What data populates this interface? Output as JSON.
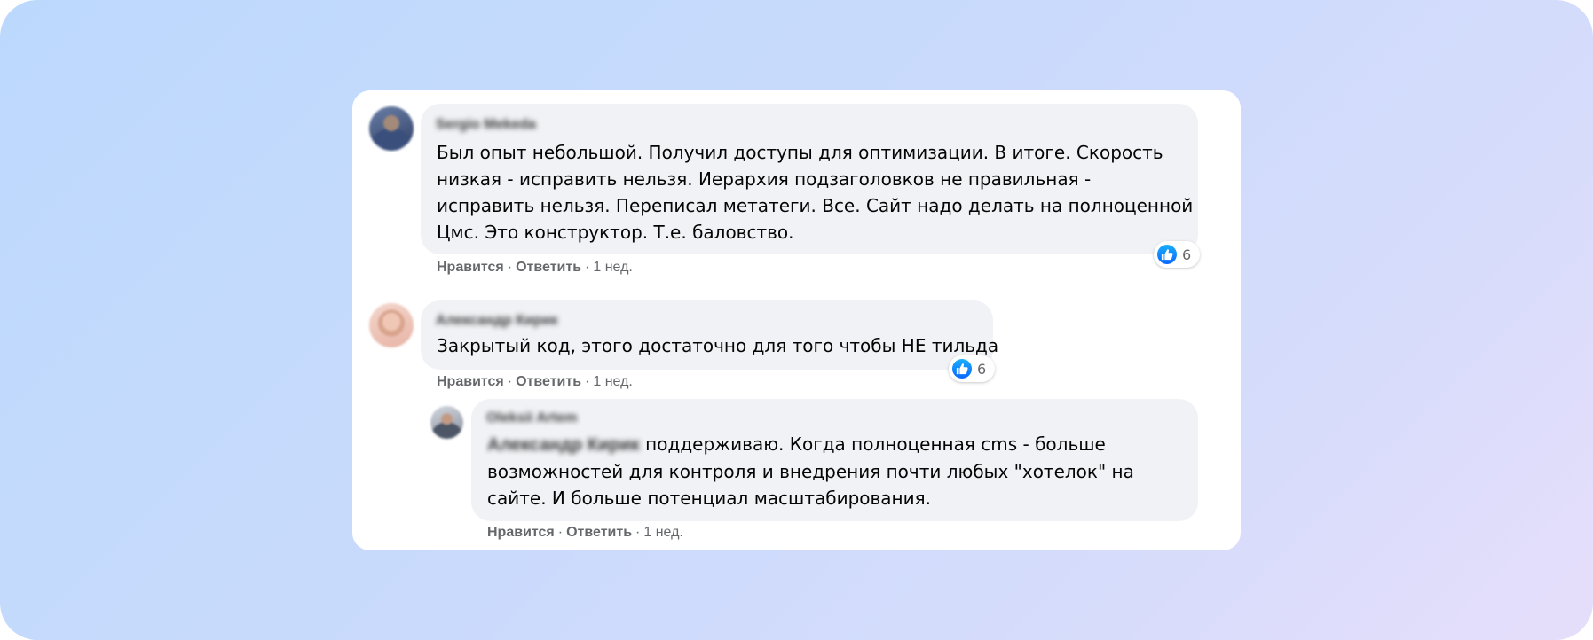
{
  "comments": [
    {
      "author": "Sergio Mekeda",
      "lines": [
        "Был опыт небольшой. Получил доступы для оптимизации. В итоге. Скорость",
        "низкая - исправить нельзя. Иерархия подзаголовков не правильная -",
        "исправить нельзя. Переписал метатеги. Все. Сайт надо делать на полноценной",
        "Цмс. Это конструктор. Т.е. баловство."
      ],
      "reactions": "6",
      "like_label": "Нравится",
      "reply_label": "Ответить",
      "time": "1 нед."
    },
    {
      "author": "Александр Кирик",
      "lines": [
        "Закрытый код, этого достаточно для того чтобы НЕ тильда"
      ],
      "reactions": "6",
      "like_label": "Нравится",
      "reply_label": "Ответить",
      "time": "1 нед."
    }
  ],
  "reply": {
    "author": "Oleksii Artem",
    "mention": "Александр Кирик",
    "line1_rest": " поддерживаю. Когда полноценная cms - больше",
    "line2": "возможностей для контроля и внедрения почти любых \"хотелок\" на",
    "line3": "сайте. И больше потенциал масштабирования.",
    "like_label": "Нравится",
    "reply_label": "Ответить",
    "time": "1 нед."
  },
  "separator": "·",
  "icons": {
    "reaction": "like-icon"
  },
  "colors": {
    "like": "#0866ff",
    "bubble": "#f0f2f5",
    "meta": "#65676b"
  }
}
